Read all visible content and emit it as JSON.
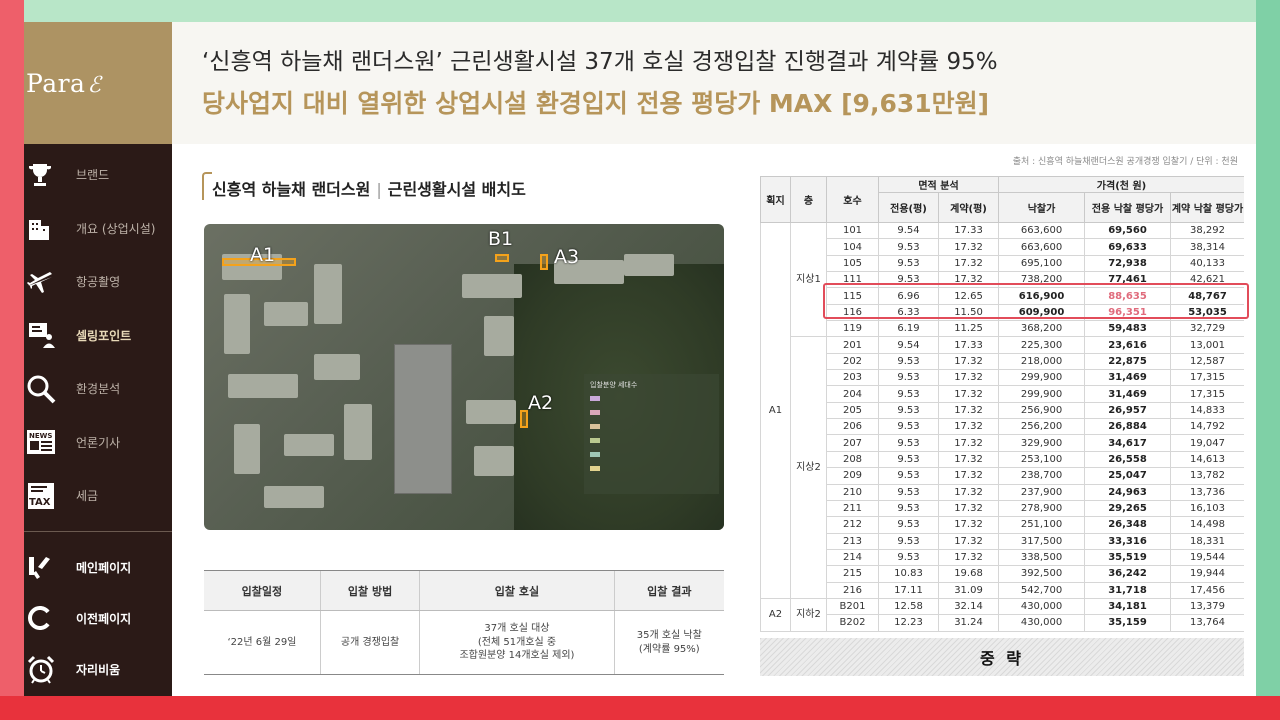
{
  "sidebar": {
    "logo": "Para",
    "items": [
      {
        "label": "브랜드",
        "icon": "trophy-icon"
      },
      {
        "label": "개요 (상업시설)",
        "icon": "building-icon"
      },
      {
        "label": "항공촬영",
        "icon": "airplane-icon"
      },
      {
        "label": "셀링포인트",
        "icon": "presentation-icon"
      },
      {
        "label": "환경분석",
        "icon": "magnifier-icon"
      },
      {
        "label": "언론기사",
        "icon": "news-icon"
      },
      {
        "label": "세금",
        "icon": "tax-icon"
      }
    ],
    "bottom_items": [
      {
        "label": "메인페이지",
        "icon": "home-icon"
      },
      {
        "label": "이전페이지",
        "icon": "back-icon"
      },
      {
        "label": "자리비움",
        "icon": "alarm-clock-icon"
      }
    ]
  },
  "header": {
    "title1": "‘신흥역 하늘채 랜더스원’ 근린생활시설 37개 호실 경쟁입찰 진행결과 계약률 95%",
    "title2": "당사업지 대비 열위한 상업시설 환경입지 전용 평당가 MAX [9,631만원]"
  },
  "site": {
    "title": "신흥역 하늘채 랜더스원",
    "subtitle": "근린생활시설 배치도",
    "map_labels": [
      "A1",
      "B1",
      "A3",
      "A2"
    ],
    "legend_title": "입찰분양 세대수"
  },
  "schedule": {
    "headers": [
      "입찰일정",
      "입찰 방법",
      "입찰 호실",
      "입찰 결과"
    ],
    "date": "‘22년 6월 29일",
    "method": "공개 경쟁입찰",
    "units_line1": "37개 호실 대상",
    "units_line2": "(전체 51개호실 중",
    "units_line3": "조합원분양 14개호실 제외)",
    "result_line1": "35개 호실 낙찰",
    "result_line2": "(계약률 95%)"
  },
  "source": "출처 : 신흥역 하늘채랜더스원 공개경쟁 입찰기 / 단위 : 천원",
  "table": {
    "h_block": "획지",
    "h_floor": "층",
    "h_unit": "호수",
    "h_area": "면적 분석",
    "h_area_exclusive": "전용(평)",
    "h_area_contract": "계약(평)",
    "h_price": "가격(천 원)",
    "h_bid": "낙찰가",
    "h_excl_pp": "전용 낙찰 평당가",
    "h_contract_pp": "계약 낙찰 평당가",
    "block_a1": "A1",
    "block_a2": "A2",
    "floor_g1": "지상1",
    "floor_g2": "지상2",
    "floor_b2": "지하2",
    "rows": [
      [
        "101",
        "9.54",
        "17.33",
        "663,600",
        "69,560",
        "38,292"
      ],
      [
        "104",
        "9.53",
        "17.32",
        "663,600",
        "69,633",
        "38,314"
      ],
      [
        "105",
        "9.53",
        "17.32",
        "695,100",
        "72,938",
        "40,133"
      ],
      [
        "111",
        "9.53",
        "17.32",
        "738,200",
        "77,461",
        "42,621"
      ],
      [
        "115",
        "6.96",
        "12.65",
        "616,900",
        "88,635",
        "48,767"
      ],
      [
        "116",
        "6.33",
        "11.50",
        "609,900",
        "96,351",
        "53,035"
      ],
      [
        "119",
        "6.19",
        "11.25",
        "368,200",
        "59,483",
        "32,729"
      ],
      [
        "201",
        "9.54",
        "17.33",
        "225,300",
        "23,616",
        "13,001"
      ],
      [
        "202",
        "9.53",
        "17.32",
        "218,000",
        "22,875",
        "12,587"
      ],
      [
        "203",
        "9.53",
        "17.32",
        "299,900",
        "31,469",
        "17,315"
      ],
      [
        "204",
        "9.53",
        "17.32",
        "299,900",
        "31,469",
        "17,315"
      ],
      [
        "205",
        "9.53",
        "17.32",
        "256,900",
        "26,957",
        "14,833"
      ],
      [
        "206",
        "9.53",
        "17.32",
        "256,200",
        "26,884",
        "14,792"
      ],
      [
        "207",
        "9.53",
        "17.32",
        "329,900",
        "34,617",
        "19,047"
      ],
      [
        "208",
        "9.53",
        "17.32",
        "253,100",
        "26,558",
        "14,613"
      ],
      [
        "209",
        "9.53",
        "17.32",
        "238,700",
        "25,047",
        "13,782"
      ],
      [
        "210",
        "9.53",
        "17.32",
        "237,900",
        "24,963",
        "13,736"
      ],
      [
        "211",
        "9.53",
        "17.32",
        "278,900",
        "29,265",
        "16,103"
      ],
      [
        "212",
        "9.53",
        "17.32",
        "251,100",
        "26,348",
        "14,498"
      ],
      [
        "213",
        "9.53",
        "17.32",
        "317,500",
        "33,316",
        "18,331"
      ],
      [
        "214",
        "9.53",
        "17.32",
        "338,500",
        "35,519",
        "19,544"
      ],
      [
        "215",
        "10.83",
        "19.68",
        "392,500",
        "36,242",
        "19,944"
      ],
      [
        "216",
        "17.11",
        "31.09",
        "542,700",
        "31,718",
        "17,456"
      ],
      [
        "B201",
        "12.58",
        "32.14",
        "430,000",
        "34,181",
        "13,379"
      ],
      [
        "B202",
        "12.23",
        "31.24",
        "430,000",
        "35,159",
        "13,764"
      ]
    ],
    "omitted": "중 략"
  },
  "colors": {
    "accent_gold": "#b6955a",
    "sidebar_bg": "#2b1a17",
    "highlight_red": "#e24c5a",
    "highlight_pink": "#e06b7c"
  }
}
